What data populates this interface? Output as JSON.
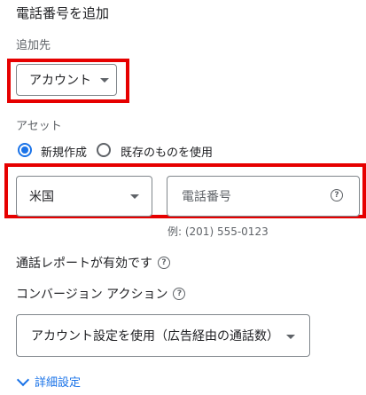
{
  "title": "電話番号を追加",
  "destination": {
    "label": "追加先",
    "value": "アカウント"
  },
  "asset": {
    "label": "アセット",
    "options": [
      {
        "label": "新規作成",
        "selected": true
      },
      {
        "label": "既存のものを使用",
        "selected": false
      }
    ]
  },
  "phone": {
    "country": "米国",
    "placeholder": "電話番号",
    "example": "例: (201) 555-0123"
  },
  "call_reports": {
    "label": "通話レポートが有効です"
  },
  "conversion": {
    "label": "コンバージョン アクション",
    "value": "アカウント設定を使用（広告経由の通話数）"
  },
  "advanced": {
    "label": "詳細設定"
  },
  "icons": {
    "help": "help-circle-icon",
    "dropdown": "triangle-down-icon",
    "expand": "chevron-down-icon"
  },
  "colors": {
    "accent": "#1a73e8",
    "highlight": "#e60000",
    "text": "#202124",
    "muted": "#5f6368"
  }
}
